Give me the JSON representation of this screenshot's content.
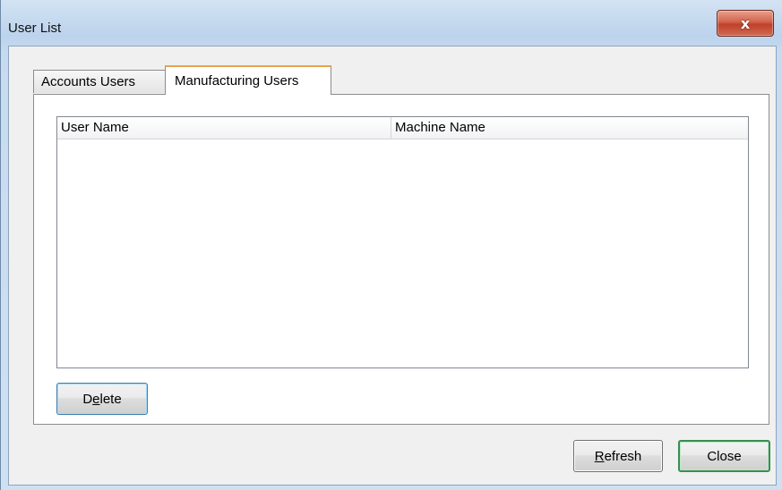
{
  "window": {
    "title": "User List",
    "close_glyph": "x"
  },
  "tabs": [
    {
      "label": "Accounts Users",
      "active": false
    },
    {
      "label": "Manufacturing Users",
      "active": true
    }
  ],
  "list": {
    "columns": [
      "User Name",
      "Machine Name"
    ],
    "rows": []
  },
  "buttons": {
    "delete": {
      "pre": "D",
      "mnemonic": "e",
      "post": "lete"
    },
    "refresh": {
      "pre": "",
      "mnemonic": "R",
      "post": "efresh"
    },
    "close": "Close"
  },
  "colors": {
    "active_tab_accent": "#e8a44c",
    "close_button": "#c0412a",
    "default_button_border": "#3a8d52"
  }
}
